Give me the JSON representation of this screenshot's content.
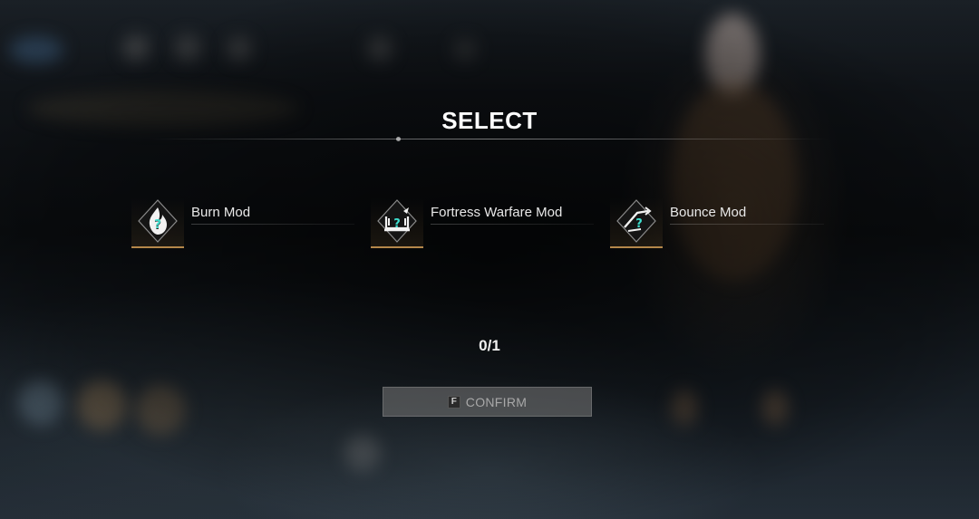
{
  "screen": {
    "title": "SELECT"
  },
  "options": [
    {
      "label": "Burn Mod",
      "icon": "burn-mod-icon"
    },
    {
      "label": "Fortress Warfare Mod",
      "icon": "fortress-warfare-mod-icon"
    },
    {
      "label": "Bounce Mod",
      "icon": "bounce-mod-icon"
    }
  ],
  "selection": {
    "counter": "0/1",
    "selected": 0,
    "max": 1
  },
  "confirm": {
    "key": "F",
    "label": "CONFIRM",
    "enabled": false
  },
  "colors": {
    "accent_gold": "#b4874a",
    "icon_teal": "#3ee0d0",
    "text": "#e8e8e8"
  }
}
